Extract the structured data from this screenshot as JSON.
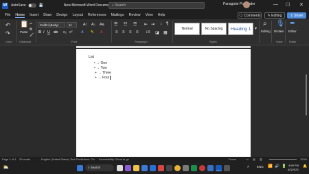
{
  "titlebar": {
    "autosave": "AutoSave",
    "toggle_state": "Off",
    "document_title": "New Microsoft Word Document",
    "search_placeholder": "Search",
    "user_name": "Panagiote Pozmader"
  },
  "menu": {
    "items": [
      "File",
      "Home",
      "Insert",
      "Draw",
      "Design",
      "Layout",
      "References",
      "Mailings",
      "Review",
      "View",
      "Help"
    ],
    "active": "Home"
  },
  "actions": {
    "comments": "Comments",
    "editing": "Editing",
    "share": "Share"
  },
  "ribbon": {
    "font_name": "Calibri (Body)",
    "font_size": "11",
    "styles": [
      "Normal",
      "No Spacing",
      "Heading 1"
    ],
    "group_labels": [
      "Undo",
      "Clipboard",
      "Font",
      "Paragraph",
      "Styles",
      "Voice",
      "Editor"
    ],
    "buttons": {
      "paste": "Paste",
      "editing": "Editing",
      "dictate": "Dictate",
      "editor": "Editor"
    }
  },
  "document": {
    "heading": "List",
    "items": [
      {
        "bullet": "•",
        "text": "One"
      },
      {
        "bullet": "•",
        "text": "Two"
      },
      {
        "bullet": "➢",
        "text": "Three"
      },
      {
        "bullet": "➢",
        "text": "Four"
      }
    ]
  },
  "statusbar": {
    "page": "Page 1 of 1",
    "words": "25 words",
    "language": "English (United States)",
    "predictions": "Text Predictions: On",
    "accessibility": "Accessibility: Good to go",
    "focus": "Focus",
    "zoom": "100%"
  },
  "taskbar": {
    "search": "Search",
    "language": "ENG",
    "time": "4:59 PM",
    "date": "4/3/2023"
  }
}
